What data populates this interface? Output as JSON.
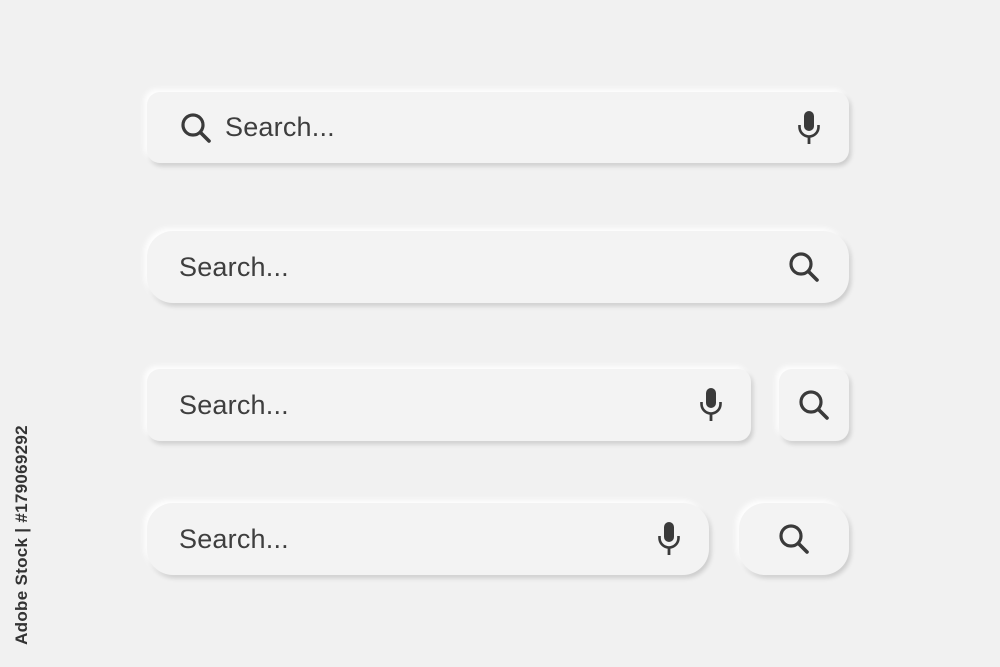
{
  "search_bars": [
    {
      "placeholder": "Search...",
      "leading_icon": "search-icon",
      "trailing_icon": "microphone-icon"
    },
    {
      "placeholder": "Search...",
      "trailing_icon": "search-icon"
    },
    {
      "placeholder": "Search...",
      "trailing_icon": "microphone-icon",
      "side_button_icon": "search-icon"
    },
    {
      "placeholder": "Search...",
      "trailing_icon": "microphone-icon",
      "side_button_icon": "search-icon"
    }
  ],
  "stock_id": "Adobe Stock | #179069292",
  "colors": {
    "background": "#f1f1f1",
    "bar": "#f3f3f3",
    "icon": "#3a3a3a",
    "text": "#3e3e3e"
  }
}
